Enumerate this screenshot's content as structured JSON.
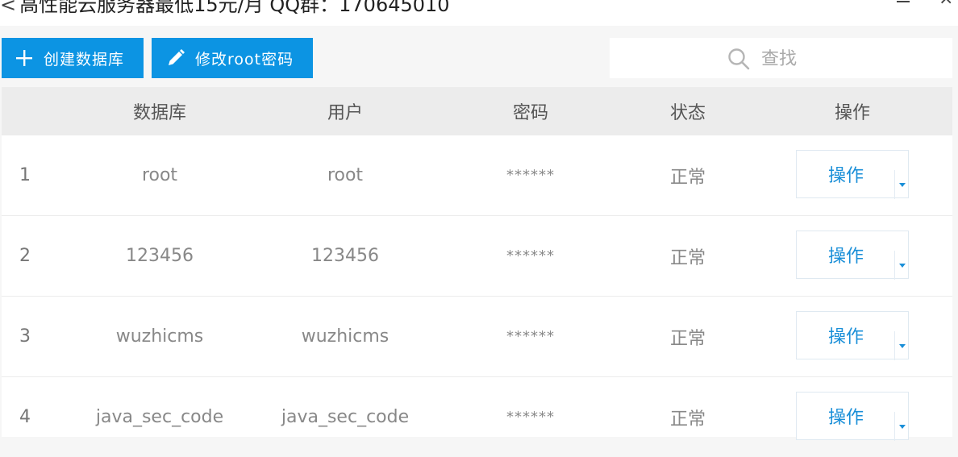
{
  "window": {
    "title": "高性能云服务器最低15元/月 QQ群：170645010",
    "title_prefix": "<",
    "minimize_icon": "minimize-icon",
    "close_icon": "close-icon",
    "close_glyph": "×"
  },
  "toolbar": {
    "create_label": "创建数据库",
    "create_icon": "plus-icon",
    "change_password_label": "修改root密码",
    "change_password_icon": "pencil-icon",
    "accent_color": "#0c94e3"
  },
  "search": {
    "placeholder": "查找",
    "icon": "search-icon"
  },
  "table": {
    "headers": {
      "no": "",
      "database": "数据库",
      "user": "用户",
      "password": "密码",
      "status": "状态",
      "actions": "操作"
    },
    "rows": [
      {
        "no": "1",
        "database": "root",
        "user": "root",
        "password": "******",
        "status": "正常",
        "action": "操作"
      },
      {
        "no": "2",
        "database": "123456",
        "user": "123456",
        "password": "******",
        "status": "正常",
        "action": "操作"
      },
      {
        "no": "3",
        "database": "wuzhicms",
        "user": "wuzhicms",
        "password": "******",
        "status": "正常",
        "action": "操作"
      },
      {
        "no": "4",
        "database": "java_sec_code",
        "user": "java_sec_code",
        "password": "******",
        "status": "正常",
        "action": "操作"
      }
    ]
  }
}
